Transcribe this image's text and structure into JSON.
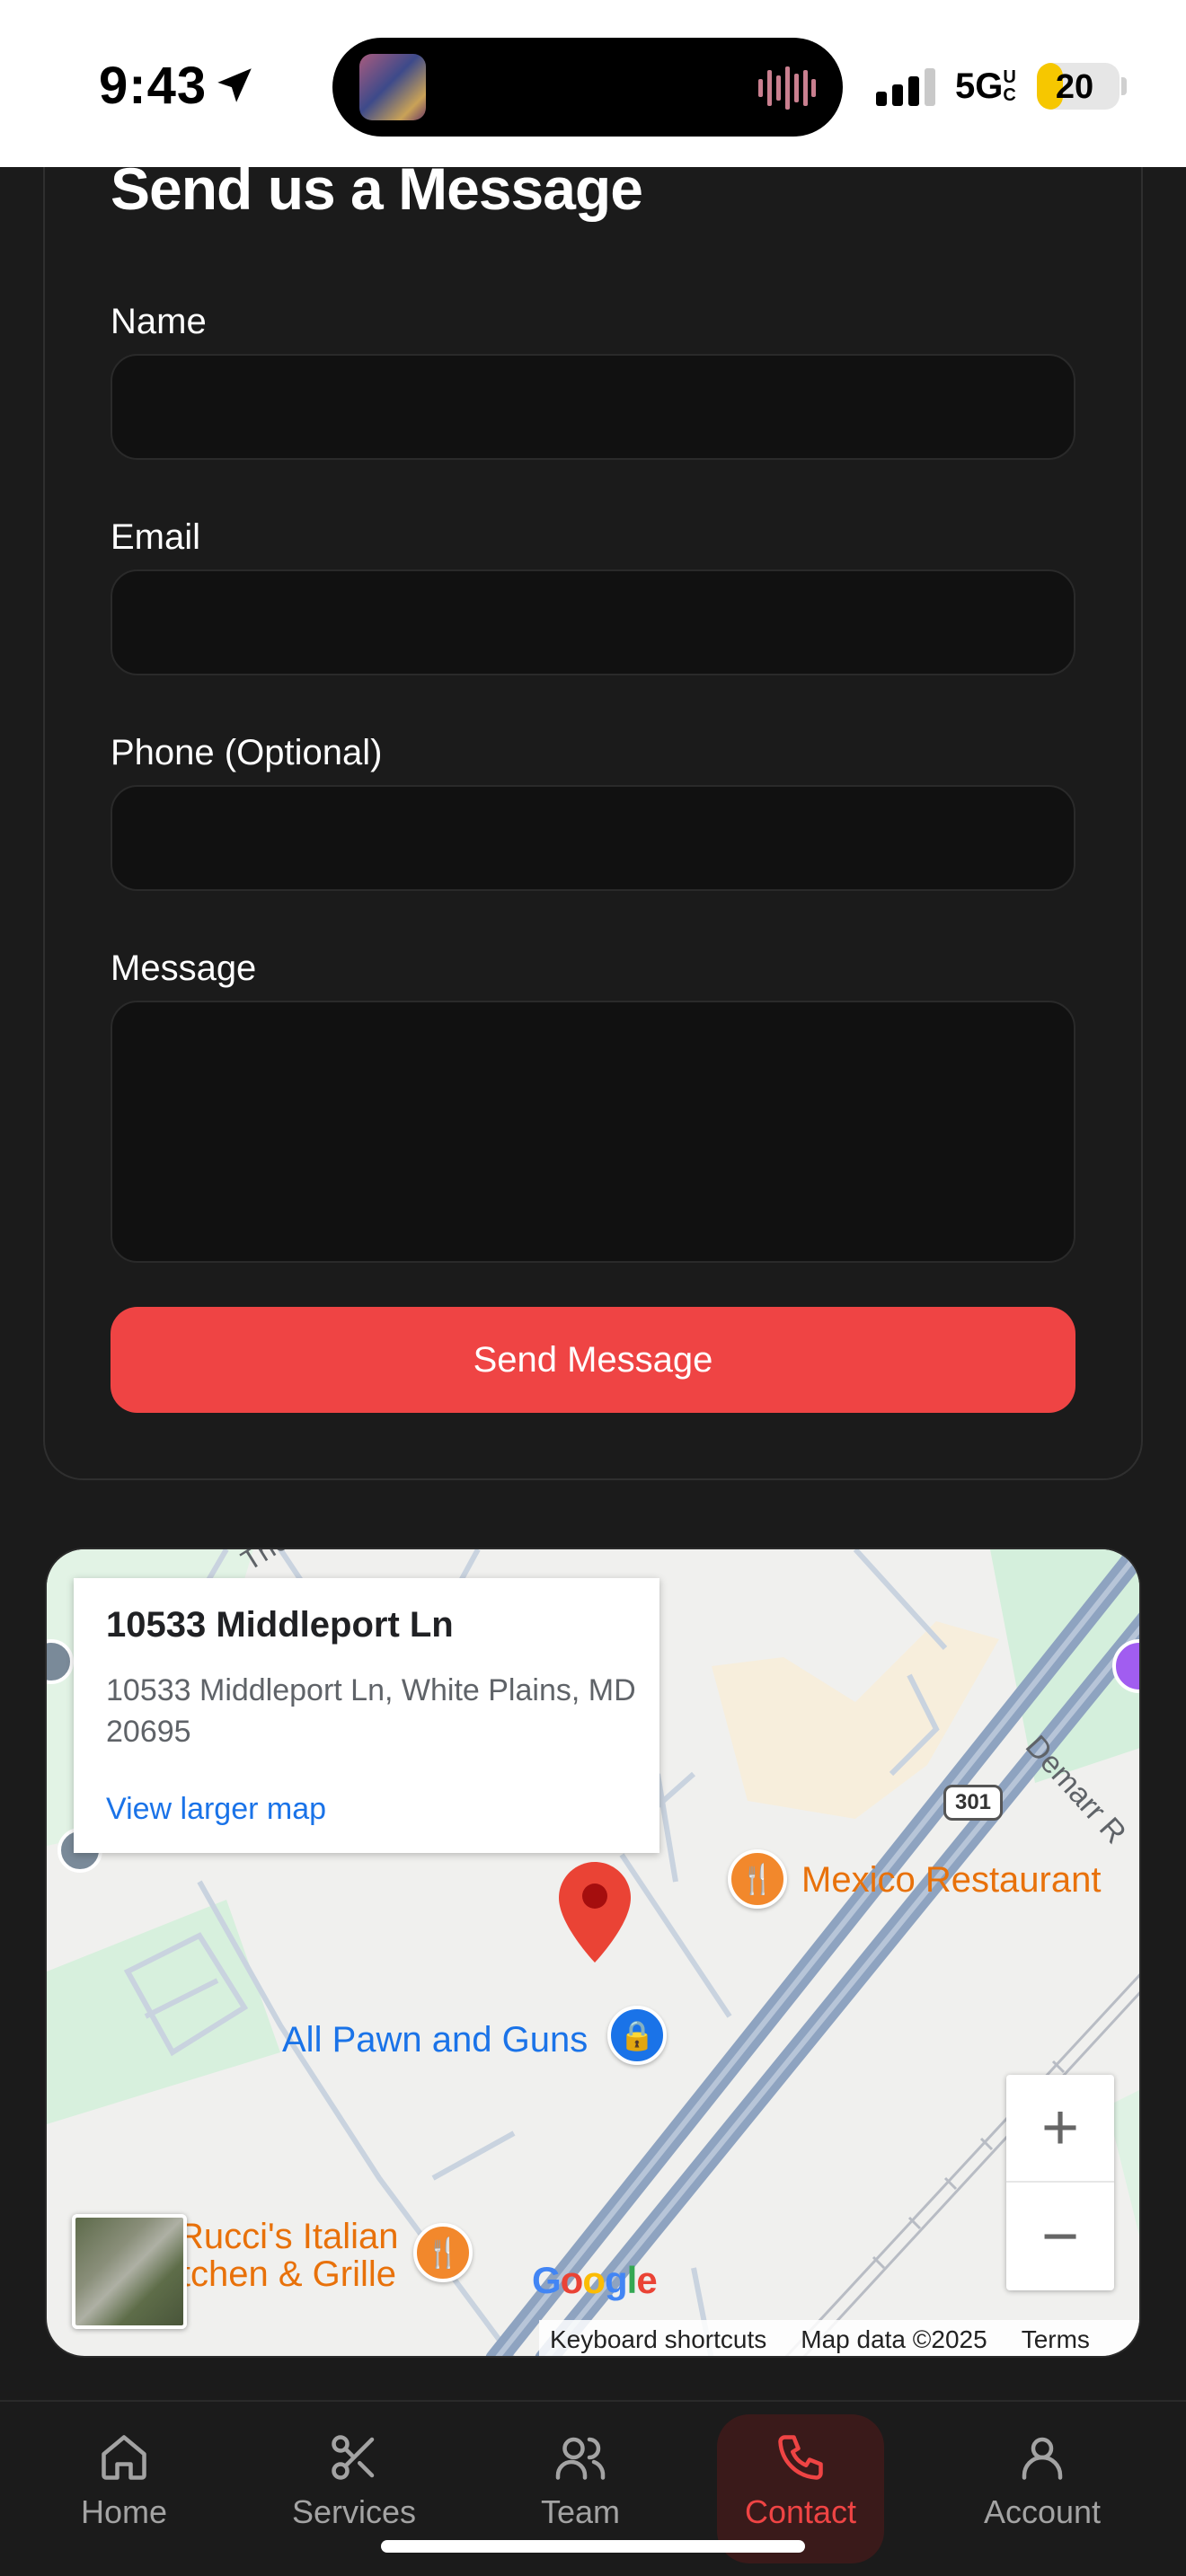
{
  "status_bar": {
    "time": "9:43",
    "network": "5G",
    "network_suffix": "UC",
    "battery": "20",
    "battery_level": 0.2,
    "icons": [
      "location-arrow-icon",
      "waveform-icon",
      "signal-bars-icon",
      "battery-icon"
    ]
  },
  "form": {
    "title": "Send us a Message",
    "name_label": "Name",
    "name_value": "",
    "email_label": "Email",
    "email_value": "",
    "phone_label": "Phone (Optional)",
    "phone_value": "",
    "message_label": "Message",
    "message_value": "",
    "submit_label": "Send Message",
    "accent": "#ef4444"
  },
  "map": {
    "info_title": "10533 Middleport Ln",
    "info_address": "10533 Middleport Ln, White Plains, MD 20695",
    "info_link": "View larger map",
    "pois": {
      "mexico": "Mexico Restaurant",
      "pawn": "All Pawn and Guns",
      "ruccis_line1": "Rucci's Italian",
      "ruccis_line2": "itchen & Grille"
    },
    "road_labels": {
      "demarr": "Demarr R",
      "the": "The",
      "route": "301"
    },
    "zoom_in": "+",
    "zoom_out": "−",
    "google": [
      "G",
      "o",
      "o",
      "g",
      "l",
      "e"
    ],
    "attribution": {
      "shortcuts": "Keyboard shortcuts",
      "data": "Map data ©2025",
      "terms": "Terms"
    }
  },
  "nav": {
    "items": [
      {
        "label": "Home",
        "icon": "home-icon"
      },
      {
        "label": "Services",
        "icon": "scissors-icon"
      },
      {
        "label": "Team",
        "icon": "users-icon"
      },
      {
        "label": "Contact",
        "icon": "phone-icon",
        "active": true
      },
      {
        "label": "Account",
        "icon": "user-icon"
      }
    ]
  }
}
